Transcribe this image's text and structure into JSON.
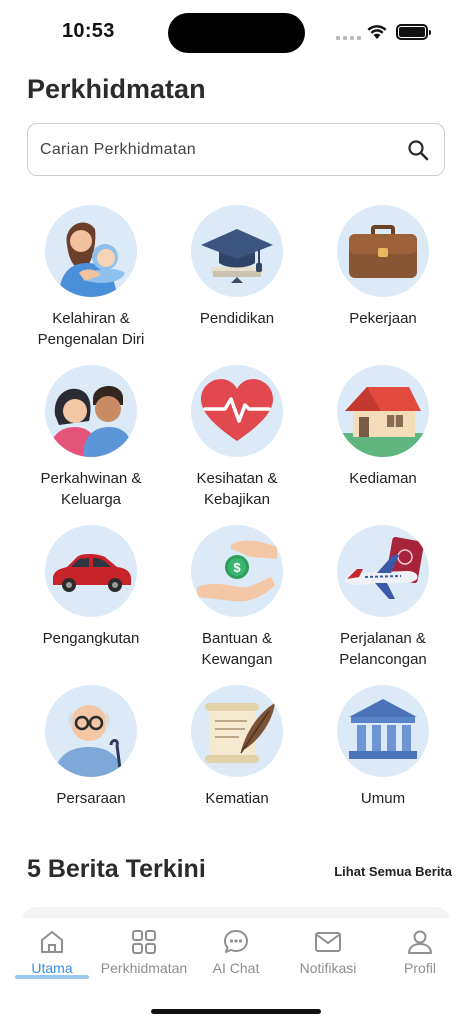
{
  "status_bar": {
    "time": "10:53"
  },
  "page_title": "Perkhidmatan",
  "search": {
    "placeholder": "Carian Perkhidmatan",
    "value": ""
  },
  "services": [
    {
      "label": "Kelahiran & Pengenalan Diri",
      "icon": "mother-baby-icon"
    },
    {
      "label": "Pendidikan",
      "icon": "graduation-cap-icon"
    },
    {
      "label": "Pekerjaan",
      "icon": "briefcase-icon"
    },
    {
      "label": "Perkahwinan & Keluarga",
      "icon": "couple-icon"
    },
    {
      "label": "Kesihatan & Kebajikan",
      "icon": "heart-pulse-icon"
    },
    {
      "label": "Kediaman",
      "icon": "house-icon"
    },
    {
      "label": "Pengangkutan",
      "icon": "car-icon"
    },
    {
      "label": "Bantuan & Kewangan",
      "icon": "money-hands-icon"
    },
    {
      "label": "Perjalanan & Pelancongan",
      "icon": "airplane-passport-icon"
    },
    {
      "label": "Persaraan",
      "icon": "elderly-man-icon"
    },
    {
      "label": "Kematian",
      "icon": "scroll-quill-icon"
    },
    {
      "label": "Umum",
      "icon": "government-building-icon"
    }
  ],
  "news": {
    "title": "5 Berita Terkini",
    "see_all": "Lihat Semua Berita"
  },
  "tabs": [
    {
      "label": "Utama",
      "icon": "home-icon",
      "active": true
    },
    {
      "label": "Perkhidmatan",
      "icon": "grid-icon",
      "active": false
    },
    {
      "label": "AI Chat",
      "icon": "chat-bubble-icon",
      "active": false
    },
    {
      "label": "Notifikasi",
      "icon": "envelope-icon",
      "active": false
    },
    {
      "label": "Profil",
      "icon": "user-icon",
      "active": false
    }
  ],
  "colors": {
    "accent": "#3a8ee6",
    "icon_circle": "#dce9f7",
    "inactive_tab": "#8f8f8f"
  }
}
